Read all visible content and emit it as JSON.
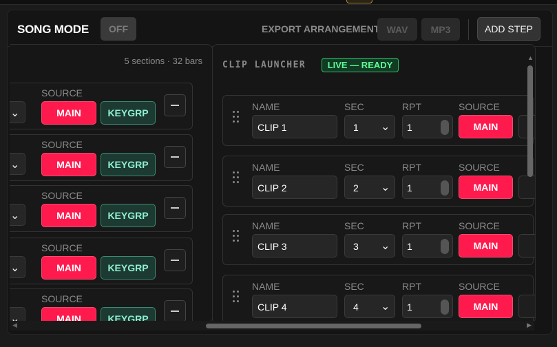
{
  "header": {
    "title": "SONG MODE",
    "mode_toggle": "OFF",
    "export_label": "EXPORT ARRANGEMENT",
    "wav_label": "WAV",
    "mp3_label": "MP3",
    "add_step_label": "ADD STEP"
  },
  "sections_panel": {
    "info": "5 sections · 32 bars",
    "rows": [
      {
        "source_label": "SOURCE",
        "main_label": "MAIN",
        "keygrp_label": "KEYGRP"
      },
      {
        "source_label": "SOURCE",
        "main_label": "MAIN",
        "keygrp_label": "KEYGRP"
      },
      {
        "source_label": "SOURCE",
        "main_label": "MAIN",
        "keygrp_label": "KEYGRP"
      },
      {
        "source_label": "SOURCE",
        "main_label": "MAIN",
        "keygrp_label": "KEYGRP"
      },
      {
        "source_label": "SOURCE",
        "main_label": "MAIN",
        "keygrp_label": "KEYGRP"
      }
    ]
  },
  "clip_launcher": {
    "title": "CLIP LAUNCHER",
    "status": "LIVE — READY",
    "columns": {
      "name": "NAME",
      "sec": "SEC",
      "rpt": "RPT",
      "source": "SOURCE"
    },
    "clips": [
      {
        "name": "CLIP 1",
        "sec": "1",
        "rpt": "1",
        "source": "MAIN"
      },
      {
        "name": "CLIP 2",
        "sec": "2",
        "rpt": "1",
        "source": "MAIN"
      },
      {
        "name": "CLIP 3",
        "sec": "3",
        "rpt": "1",
        "source": "MAIN"
      },
      {
        "name": "CLIP 4",
        "sec": "4",
        "rpt": "1",
        "source": "MAIN"
      }
    ]
  },
  "icons": {
    "chevron": "chevron-down-icon",
    "grip": "drag-handle-icon",
    "minus": "minus-icon"
  },
  "colors": {
    "main_accent": "#ff1a4d",
    "keygrp_accent": "#8ff0d0",
    "live_accent": "#5dfc95"
  }
}
